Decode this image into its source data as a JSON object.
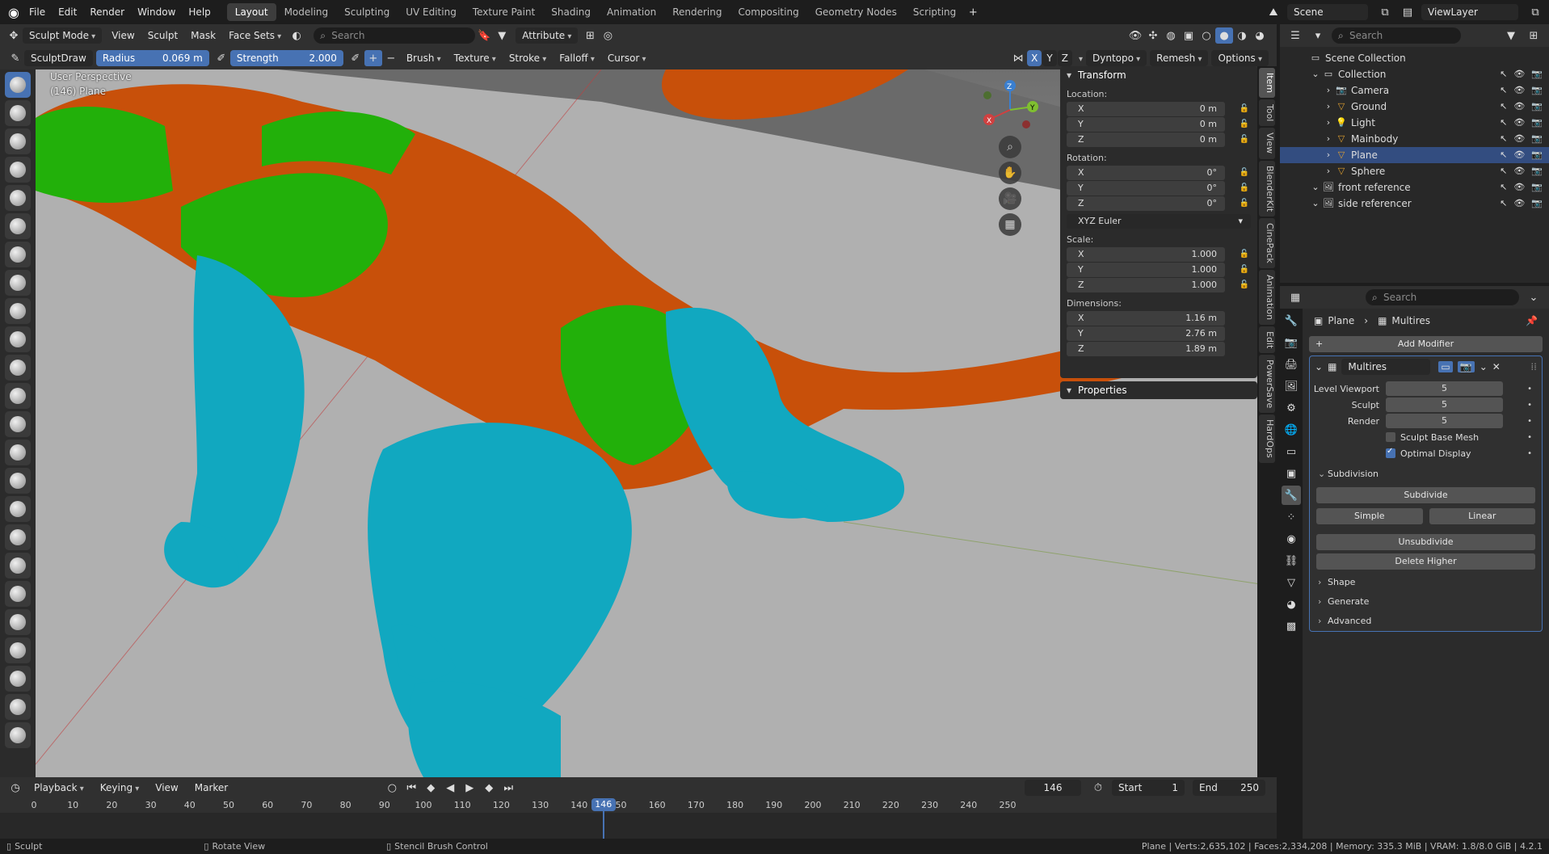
{
  "app": {
    "logo_icon": "blender-logo-icon"
  },
  "menu": [
    "File",
    "Edit",
    "Render",
    "Window",
    "Help"
  ],
  "workspaces": [
    "Layout",
    "Modeling",
    "Sculpting",
    "UV Editing",
    "Texture Paint",
    "Shading",
    "Animation",
    "Rendering",
    "Compositing",
    "Geometry Nodes",
    "Scripting"
  ],
  "workspace_active": "Layout",
  "scene": {
    "name": "Scene",
    "view_layer": "ViewLayer"
  },
  "header": {
    "mode": "Sculpt Mode",
    "view": "View",
    "sculpt": "Sculpt",
    "mask": "Mask",
    "face_sets": "Face Sets",
    "search_placeholder": "Search",
    "attribute": "Attribute"
  },
  "tool_settings": {
    "brush_name": "SculptDraw",
    "radius_label": "Radius",
    "radius_value": "0.069 m",
    "strength_label": "Strength",
    "strength_value": "2.000",
    "brush": "Brush",
    "texture": "Texture",
    "stroke": "Stroke",
    "falloff": "Falloff",
    "cursor": "Cursor",
    "x": "X",
    "y": "Y",
    "z": "Z",
    "dyntopo": "Dyntopo",
    "remesh": "Remesh",
    "options": "Options"
  },
  "viewport": {
    "perspective": "User Perspective",
    "object": "(146) Plane"
  },
  "npanel": {
    "transform_title": "Transform",
    "location_label": "Location:",
    "location": [
      {
        "axis": "X",
        "value": "0 m"
      },
      {
        "axis": "Y",
        "value": "0 m"
      },
      {
        "axis": "Z",
        "value": "0 m"
      }
    ],
    "rotation_label": "Rotation:",
    "rotation": [
      {
        "axis": "X",
        "value": "0°"
      },
      {
        "axis": "Y",
        "value": "0°"
      },
      {
        "axis": "Z",
        "value": "0°"
      }
    ],
    "rotation_mode": "XYZ Euler",
    "scale_label": "Scale:",
    "scale": [
      {
        "axis": "X",
        "value": "1.000"
      },
      {
        "axis": "Y",
        "value": "1.000"
      },
      {
        "axis": "Z",
        "value": "1.000"
      }
    ],
    "dimensions_label": "Dimensions:",
    "dimensions": [
      {
        "axis": "X",
        "value": "1.16 m"
      },
      {
        "axis": "Y",
        "value": "2.76 m"
      },
      {
        "axis": "Z",
        "value": "1.89 m"
      }
    ],
    "properties_title": "Properties",
    "tabs": [
      "Item",
      "Tool",
      "View",
      "BlenderKit",
      "CinePack",
      "Animation",
      "Edit",
      "PowerSave",
      "HardOps"
    ]
  },
  "outliner": {
    "search_placeholder": "Search",
    "rows": [
      {
        "label": "Scene Collection",
        "indent": 0,
        "icon": "collection-icon"
      },
      {
        "label": "Collection",
        "indent": 1,
        "icon": "collection-icon"
      },
      {
        "label": "Camera",
        "indent": 2,
        "icon": "camera-icon"
      },
      {
        "label": "Ground",
        "indent": 2,
        "icon": "mesh-icon"
      },
      {
        "label": "Light",
        "indent": 2,
        "icon": "light-icon"
      },
      {
        "label": "Mainbody",
        "indent": 2,
        "icon": "mesh-icon"
      },
      {
        "label": "Plane",
        "indent": 2,
        "icon": "mesh-icon",
        "selected": true
      },
      {
        "label": "Sphere",
        "indent": 2,
        "icon": "mesh-icon"
      },
      {
        "label": "front reference",
        "indent": 1,
        "icon": "image-icon"
      },
      {
        "label": "side referencer",
        "indent": 1,
        "icon": "image-icon"
      }
    ]
  },
  "properties": {
    "search_placeholder": "Search",
    "breadcrumb_object": "Plane",
    "breadcrumb_modifier": "Multires",
    "add_modifier": "Add Modifier",
    "modifier_name": "Multires",
    "level_viewport_label": "Level Viewport",
    "level_viewport": "5",
    "sculpt_label": "Sculpt",
    "sculpt": "5",
    "render_label": "Render",
    "render": "5",
    "sculpt_base_mesh": "Sculpt Base Mesh",
    "optimal_display": "Optimal Display",
    "subdivision": "Subdivision",
    "subdivide": "Subdivide",
    "simple": "Simple",
    "linear": "Linear",
    "unsubdivide": "Unsubdivide",
    "delete_higher": "Delete Higher",
    "shape": "Shape",
    "generate": "Generate",
    "advanced": "Advanced"
  },
  "timeline": {
    "playback": "Playback",
    "keying": "Keying",
    "view": "View",
    "marker": "Marker",
    "current_frame": "146",
    "start_label": "Start",
    "start": "1",
    "end_label": "End",
    "end": "250",
    "ticks": [
      "0",
      "10",
      "20",
      "30",
      "40",
      "50",
      "60",
      "70",
      "80",
      "90",
      "100",
      "110",
      "120",
      "130",
      "140",
      "150",
      "160",
      "170",
      "180",
      "190",
      "200",
      "210",
      "220",
      "230",
      "240",
      "250"
    ]
  },
  "status": {
    "left1": "Sculpt",
    "left2": "Rotate View",
    "left3": "Stencil Brush Control",
    "right": "Plane | Verts:2,635,102 | Faces:2,334,208 | Memory: 335.3 MiB | VRAM: 1.8/8.0 GiB | 4.2.1"
  },
  "colors": {
    "accent": "#4772b3",
    "body_orange": "#c8500a",
    "green": "#22b00a",
    "cyan": "#11a8c0"
  }
}
